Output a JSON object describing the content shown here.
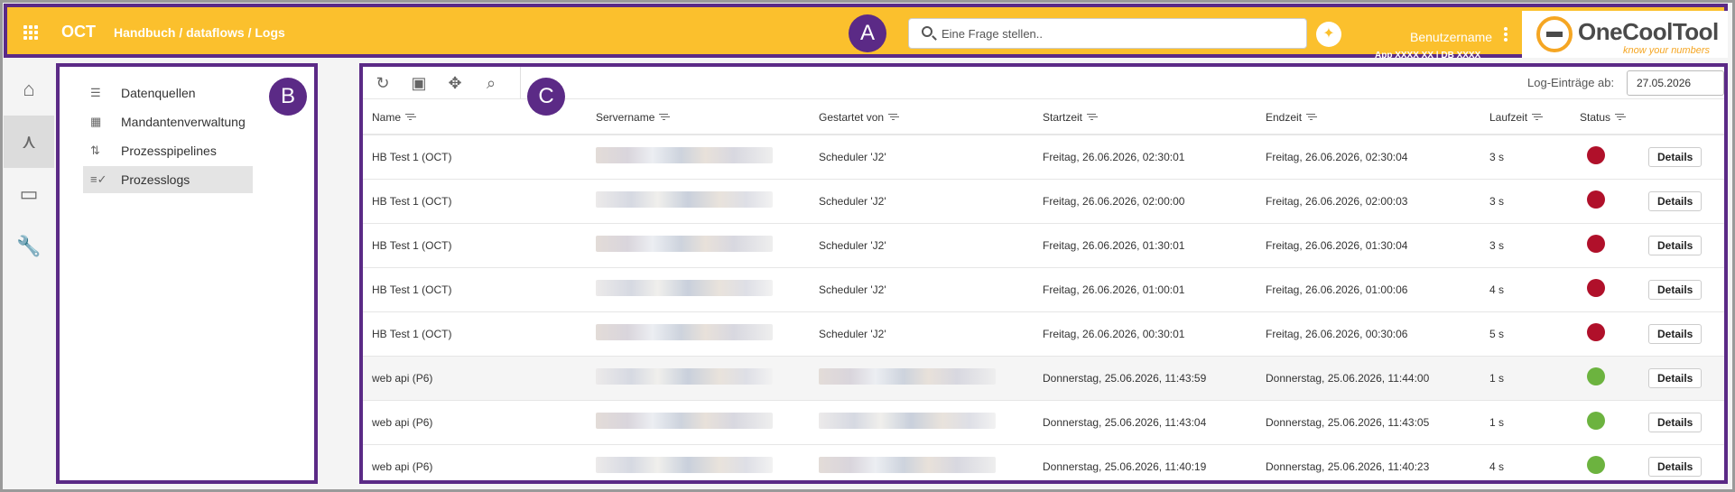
{
  "header": {
    "brand": "OCT",
    "breadcrumb": "Handbuch / dataflows / Logs",
    "search_placeholder": "Eine Frage stellen..",
    "username": "Benutzername",
    "app_info": "App XXXX XX | DB XXXX",
    "logo_text": "OneCoolTool",
    "logo_tagline": "know your numbers"
  },
  "markers": {
    "a": "A",
    "b": "B",
    "c": "C"
  },
  "rail": {
    "items": [
      {
        "icon": "home-icon",
        "glyph": "⌂"
      },
      {
        "icon": "dataflow-icon",
        "glyph": "⋏"
      },
      {
        "icon": "window-icon",
        "glyph": "▭"
      },
      {
        "icon": "wrench-icon",
        "glyph": "🔧"
      }
    ]
  },
  "sidebar": {
    "items": [
      {
        "label": "Datenquellen",
        "icon": "list-icon",
        "glyph": "☰"
      },
      {
        "label": "Mandantenverwaltung",
        "icon": "building-icon",
        "glyph": "▦"
      },
      {
        "label": "Prozesspipelines",
        "icon": "pipeline-icon",
        "glyph": "⇅"
      },
      {
        "label": "Prozesslogs",
        "icon": "list-check-icon",
        "glyph": "≡✓"
      }
    ]
  },
  "toolbar": {
    "log_label": "Log-Einträge ab:",
    "log_date": "27.05.2026"
  },
  "table": {
    "headers": {
      "name": "Name",
      "server": "Servername",
      "started_by": "Gestartet von",
      "start": "Startzeit",
      "end": "Endzeit",
      "runtime": "Laufzeit",
      "status": "Status"
    },
    "details_label": "Details",
    "status_colors": {
      "error": "#b0102a",
      "success": "#6cb33f"
    },
    "rows": [
      {
        "name": "HB Test 1 (OCT)",
        "started_by": "Scheduler 'J2'",
        "start": "Freitag, 26.06.2026, 02:30:01",
        "end": "Freitag, 26.06.2026, 02:30:04",
        "runtime": "3 s",
        "status": "error"
      },
      {
        "name": "HB Test 1 (OCT)",
        "started_by": "Scheduler 'J2'",
        "start": "Freitag, 26.06.2026, 02:00:00",
        "end": "Freitag, 26.06.2026, 02:00:03",
        "runtime": "3 s",
        "status": "error"
      },
      {
        "name": "HB Test 1 (OCT)",
        "started_by": "Scheduler 'J2'",
        "start": "Freitag, 26.06.2026, 01:30:01",
        "end": "Freitag, 26.06.2026, 01:30:04",
        "runtime": "3 s",
        "status": "error"
      },
      {
        "name": "HB Test 1 (OCT)",
        "started_by": "Scheduler 'J2'",
        "start": "Freitag, 26.06.2026, 01:00:01",
        "end": "Freitag, 26.06.2026, 01:00:06",
        "runtime": "4 s",
        "status": "error"
      },
      {
        "name": "HB Test 1 (OCT)",
        "started_by": "Scheduler 'J2'",
        "start": "Freitag, 26.06.2026, 00:30:01",
        "end": "Freitag, 26.06.2026, 00:30:06",
        "runtime": "5 s",
        "status": "error"
      },
      {
        "name": "web api (P6)",
        "started_by": "",
        "start": "Donnerstag, 25.06.2026, 11:43:59",
        "end": "Donnerstag, 25.06.2026, 11:44:00",
        "runtime": "1 s",
        "status": "success"
      },
      {
        "name": "web api (P6)",
        "started_by": "",
        "start": "Donnerstag, 25.06.2026, 11:43:04",
        "end": "Donnerstag, 25.06.2026, 11:43:05",
        "runtime": "1 s",
        "status": "success"
      },
      {
        "name": "web api (P6)",
        "started_by": "",
        "start": "Donnerstag, 25.06.2026, 11:40:19",
        "end": "Donnerstag, 25.06.2026, 11:40:23",
        "runtime": "4 s",
        "status": "success"
      }
    ]
  }
}
